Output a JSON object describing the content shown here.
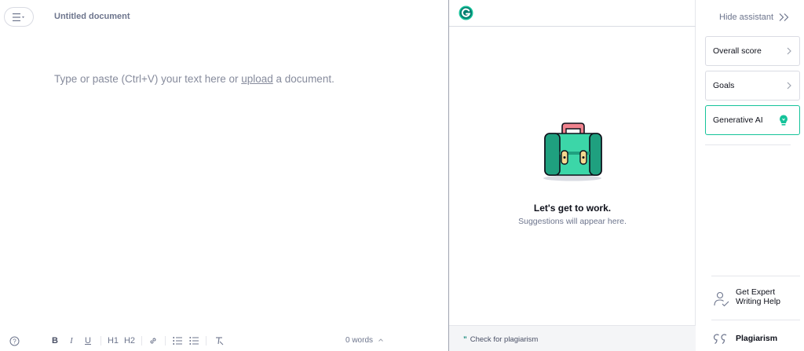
{
  "editor": {
    "document_title": "Untitled document",
    "placeholder_before": "Type or paste (Ctrl+V) your text here or ",
    "placeholder_link": "upload",
    "placeholder_after": " a document.",
    "word_count": "0 words"
  },
  "toolbar": {
    "help": "?",
    "bold": "B",
    "italic": "I",
    "underline": "U",
    "h1": "H1",
    "h2": "H2"
  },
  "assistant": {
    "empty_title": "Let's get to work.",
    "empty_subtitle": "Suggestions will appear here.",
    "footer_link": "Check for plagiarism",
    "footer_quote": "”"
  },
  "right_panel": {
    "hide_label": "Hide assistant",
    "cards": [
      {
        "label": "Overall score"
      },
      {
        "label": "Goals"
      },
      {
        "label": "Generative AI"
      }
    ],
    "expert_line1": "Get Expert",
    "expert_line2": "Writing Help",
    "plagiarism": "Plagiarism"
  },
  "colors": {
    "brand_green": "#15c39a",
    "dark_green": "#027e6f",
    "text_gray": "#6d758d"
  }
}
